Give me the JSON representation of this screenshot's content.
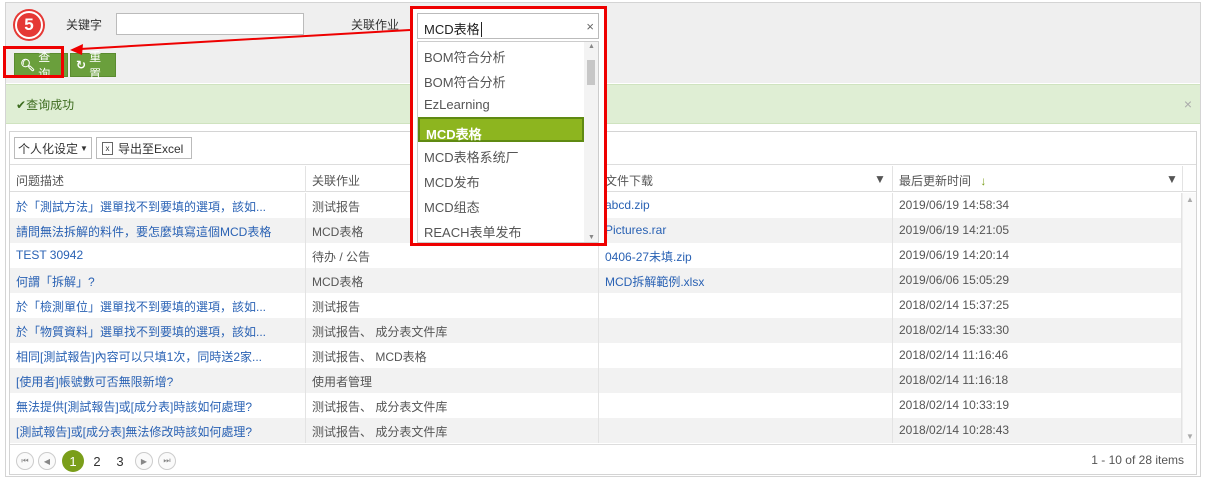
{
  "search": {
    "keyword_label": "关键字",
    "keyword_value": "",
    "related_label": "关联作业",
    "related_value": "MCD表格",
    "query_button": "查询",
    "reset_button": "重置",
    "step_badge": "5"
  },
  "status": {
    "message": "查询成功",
    "close": "×"
  },
  "toolbar": {
    "personalize": "个人化设定",
    "export": "导出至Excel"
  },
  "dropdown": {
    "clear": "×",
    "options": [
      "BOM符合分析",
      "BOM符合分析",
      "EzLearning",
      "MCD表格",
      "MCD表格系统厂",
      "MCD发布",
      "MCD组态",
      "REACH表单发布"
    ],
    "selected_index": 3
  },
  "grid": {
    "columns": {
      "description": "问题描述",
      "related": "关联作业",
      "download": "文件下载",
      "updated": "最后更新时间"
    },
    "rows": [
      {
        "description": "於「測試方法」選單找不到要填的選項，該如...",
        "related": "测试报告",
        "download": "abcd.zip",
        "updated": "2019/06/19 14:58:34"
      },
      {
        "description": "請問無法拆解的料件，要怎麼填寫這個MCD表格",
        "related": "MCD表格",
        "download": "Pictures.rar",
        "updated": "2019/06/19 14:21:05"
      },
      {
        "description": "TEST 30942",
        "related": "待办 / 公告",
        "download": "0406-27未填.zip",
        "updated": "2019/06/19 14:20:14"
      },
      {
        "description": "何謂「拆解」?",
        "related": "MCD表格",
        "download": "MCD拆解範例.xlsx",
        "updated": "2019/06/06 15:05:29"
      },
      {
        "description": "於「檢測單位」選單找不到要填的選項，該如...",
        "related": "测试报告",
        "download": "",
        "updated": "2018/02/14 15:37:25"
      },
      {
        "description": "於「物質資料」選單找不到要填的選項，該如...",
        "related": "测试报告、 成分表文件库",
        "download": "",
        "updated": "2018/02/14 15:33:30"
      },
      {
        "description": "相同[測試報告]內容可以只填1次，同時送2家...",
        "related": "测试报告、 MCD表格",
        "download": "",
        "updated": "2018/02/14 11:16:46"
      },
      {
        "description": "[使用者]帳號數可否無限新增?",
        "related": "使用者管理",
        "download": "",
        "updated": "2018/02/14 11:16:18"
      },
      {
        "description": "無法提供[測試報告]或[成分表]時該如何處理?",
        "related": "测试报告、 成分表文件库",
        "download": "",
        "updated": "2018/02/14 10:33:19"
      },
      {
        "description": "[測試報告]或[成分表]無法修改時該如何處理?",
        "related": "测试报告、 成分表文件库",
        "download": "",
        "updated": "2018/02/14 10:28:43"
      }
    ]
  },
  "pager": {
    "pages": [
      "1",
      "2",
      "3"
    ],
    "current": "1",
    "info": "1 - 10 of 28 items"
  },
  "colors": {
    "accent_green": "#6a9f3c",
    "selected_green": "#8db51f",
    "highlight_red": "#e00000",
    "link_blue": "#2a62b4"
  }
}
